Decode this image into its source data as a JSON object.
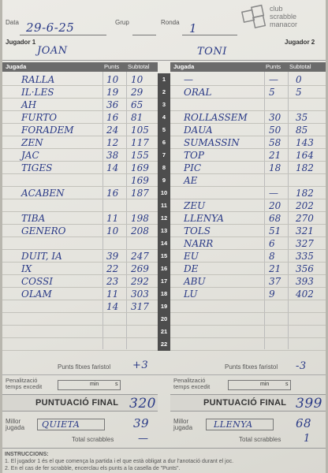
{
  "header": {
    "data_label": "Data",
    "grup_label": "Grup",
    "ronda_label": "Ronda",
    "date_value": "29-6-25",
    "ronda_value": "1",
    "logo_line1": "club",
    "logo_line2": "scrabble",
    "logo_line3": "manacor"
  },
  "players": {
    "player1_label": "Jugador 1",
    "player2_label": "Jugador 2",
    "player1_name": "JOAN",
    "player2_name": "TONI"
  },
  "columns": {
    "play": "Jugada",
    "points": "Punts",
    "subtotal": "Subtotal"
  },
  "rows": [
    {
      "n": "1",
      "p1_word": "RALLA",
      "p1_pts": "10",
      "p1_sub": "10",
      "p2_word": "—",
      "p2_pts": "—",
      "p2_sub": "0"
    },
    {
      "n": "2",
      "p1_word": "IL·LES",
      "p1_pts": "19",
      "p1_sub": "29",
      "p2_word": "ORAL",
      "p2_pts": "5",
      "p2_sub": "5"
    },
    {
      "n": "3",
      "p1_word": "AH",
      "p1_pts": "36",
      "p1_sub": "65",
      "p2_word": "",
      "p2_pts": "",
      "p2_sub": ""
    },
    {
      "n": "4",
      "p1_word": "FURTO",
      "p1_pts": "16",
      "p1_sub": "81",
      "p2_word": "ROLLASSEM",
      "p2_pts": "30",
      "p2_sub": "35"
    },
    {
      "n": "5",
      "p1_word": "FORADEM",
      "p1_pts": "24",
      "p1_sub": "105",
      "p2_word": "DAUA",
      "p2_pts": "50",
      "p2_sub": "85"
    },
    {
      "n": "6",
      "p1_word": "ZEN",
      "p1_pts": "12",
      "p1_sub": "117",
      "p2_word": "SUMASSIN",
      "p2_pts": "58",
      "p2_sub": "143"
    },
    {
      "n": "7",
      "p1_word": "JAC",
      "p1_pts": "38",
      "p1_sub": "155",
      "p2_word": "TOP",
      "p2_pts": "21",
      "p2_sub": "164"
    },
    {
      "n": "8",
      "p1_word": "TIGES",
      "p1_pts": "14",
      "p1_sub": "169",
      "p2_word": "PIC",
      "p2_pts": "18",
      "p2_sub": "182"
    },
    {
      "n": "9",
      "p1_word": "",
      "p1_pts": "",
      "p1_sub": "169",
      "p2_word": "AE",
      "p2_pts": "",
      "p2_sub": ""
    },
    {
      "n": "10",
      "p1_word": "ACABEN",
      "p1_pts": "16",
      "p1_sub": "187",
      "p2_word": "",
      "p2_pts": "—",
      "p2_sub": "182"
    },
    {
      "n": "11",
      "p1_word": "",
      "p1_pts": "",
      "p1_sub": "",
      "p2_word": "ZEU",
      "p2_pts": "20",
      "p2_sub": "202"
    },
    {
      "n": "12",
      "p1_word": "TIBA",
      "p1_pts": "11",
      "p1_sub": "198",
      "p2_word": "LLENYA",
      "p2_pts": "68",
      "p2_sub": "270"
    },
    {
      "n": "13",
      "p1_word": "GENERO",
      "p1_pts": "10",
      "p1_sub": "208",
      "p2_word": "TOLS",
      "p2_pts": "51",
      "p2_sub": "321"
    },
    {
      "n": "14",
      "p1_word": "",
      "p1_pts": "",
      "p1_sub": "",
      "p2_word": "NARR",
      "p2_pts": "6",
      "p2_sub": "327"
    },
    {
      "n": "15",
      "p1_word": "DUIT, IA",
      "p1_pts": "39",
      "p1_sub": "247",
      "p2_word": "EU",
      "p2_pts": "8",
      "p2_sub": "335"
    },
    {
      "n": "16",
      "p1_word": "IX",
      "p1_pts": "22",
      "p1_sub": "269",
      "p2_word": "DE",
      "p2_pts": "21",
      "p2_sub": "356"
    },
    {
      "n": "17",
      "p1_word": "COSSI",
      "p1_pts": "23",
      "p1_sub": "292",
      "p2_word": "ABU",
      "p2_pts": "37",
      "p2_sub": "393"
    },
    {
      "n": "18",
      "p1_word": "OLAM",
      "p1_pts": "11",
      "p1_sub": "303",
      "p2_word": "LU",
      "p2_pts": "9",
      "p2_sub": "402"
    },
    {
      "n": "19",
      "p1_word": "",
      "p1_pts": "14",
      "p1_sub": "317",
      "p2_word": "",
      "p2_pts": "",
      "p2_sub": ""
    },
    {
      "n": "20",
      "p1_word": "",
      "p1_pts": "",
      "p1_sub": "",
      "p2_word": "",
      "p2_pts": "",
      "p2_sub": ""
    },
    {
      "n": "21",
      "p1_word": "",
      "p1_pts": "",
      "p1_sub": "",
      "p2_word": "",
      "p2_pts": "",
      "p2_sub": ""
    },
    {
      "n": "22",
      "p1_word": "",
      "p1_pts": "",
      "p1_sub": "",
      "p2_word": "",
      "p2_pts": "",
      "p2_sub": ""
    }
  ],
  "footer": {
    "fixed_label": "Punts fitxes faristol",
    "p1_fixed": "+3",
    "p2_fixed": "-3",
    "penalty_label_1": "Penalització",
    "penalty_label_2": "temps excedit",
    "min_label": "min",
    "s_label": "s",
    "final_label": "PUNTUACIÓ FINAL",
    "p1_final": "320",
    "p2_final": "399",
    "best_label_1": "Millor",
    "best_label_2": "jugada",
    "p1_best_word": "QUIETA",
    "p1_best_pts": "39",
    "p2_best_word": "LLENYA",
    "p2_best_pts": "68",
    "scrabbles_label": "Total scrabbles",
    "p1_scrabbles": "—",
    "p2_scrabbles": "1",
    "instructions_title": "INSTRUCCIONS:",
    "instructions_1": "1. El jugador 1 és el que comença la partida i el que està obligat a dur l'anotació durant el joc.",
    "instructions_2": "2. En el cas de fer scrabble, encerclau els punts a la casella de \"Punts\"."
  }
}
